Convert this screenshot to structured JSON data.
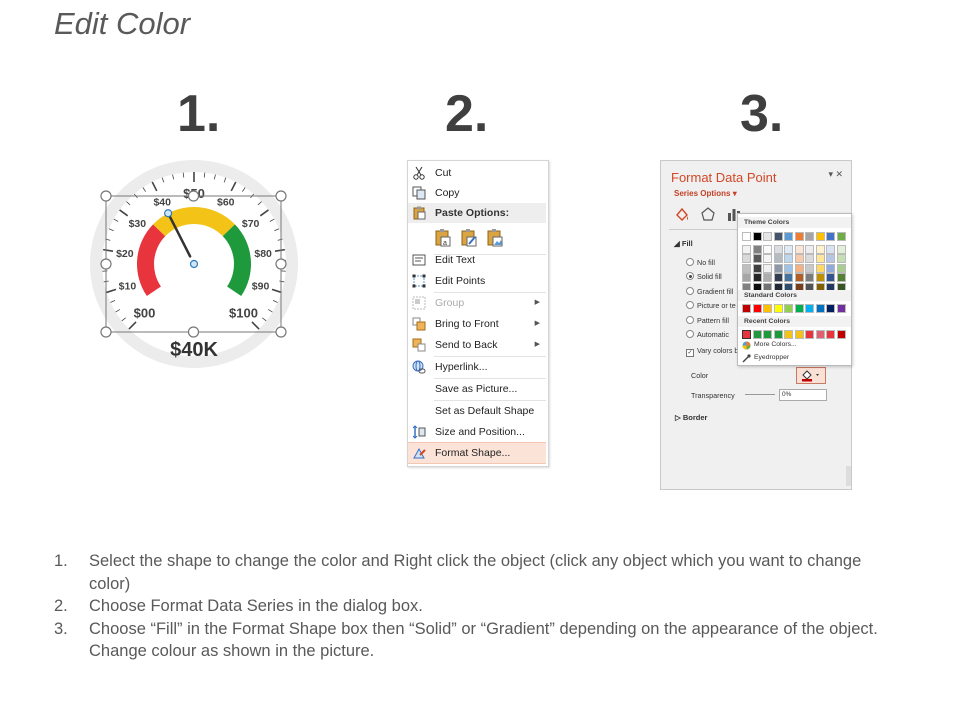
{
  "title": "Edit Color",
  "steps": [
    "1.",
    "2.",
    "3."
  ],
  "gauge": {
    "tick_labels": [
      "$00",
      "$10",
      "$20",
      "$30",
      "$40",
      "$50",
      "$60",
      "$70",
      "$80",
      "$90",
      "$100"
    ],
    "value_label": "$40K",
    "needle_value": 40,
    "band_colors": {
      "low": "#e8343c",
      "mid": "#f4c318",
      "high": "#1e9a3c"
    }
  },
  "context_menu": {
    "items": {
      "cut": "Cut",
      "copy": "Copy",
      "paste_options": "Paste Options:",
      "edit_text": "Edit Text",
      "edit_points": "Edit Points",
      "group": "Group",
      "bring_to_front": "Bring to Front",
      "send_to_back": "Send to Back",
      "hyperlink": "Hyperlink...",
      "save_as_picture": "Save as Picture...",
      "set_default_shape": "Set as Default Shape",
      "size_and_position": "Size and Position...",
      "format_shape": "Format Shape..."
    }
  },
  "format_panel": {
    "title": "Format Data Point",
    "series_options": "Series Options",
    "controls": "▾ ✕",
    "fill_section": "Fill",
    "fill_options": [
      "No fill",
      "Solid fill",
      "Gradient fill",
      "Picture or te",
      "Pattern fill",
      "Automatic"
    ],
    "selected_fill": "Solid fill",
    "vary_colors": "Vary colors b",
    "color_label": "Color",
    "transparency_label": "Transparency",
    "transparency_value": "0%",
    "border_section": "Border",
    "accent_color": "#d24726"
  },
  "color_popup": {
    "theme_colors_label": "Theme Colors",
    "standard_colors_label": "Standard Colors",
    "recent_colors_label": "Recent Colors",
    "more_colors": "More Colors...",
    "eyedropper": "Eyedropper",
    "theme_top_row": [
      "#ffffff",
      "#000000",
      "#e7e6e6",
      "#44546a",
      "#5b9bd5",
      "#ed7d31",
      "#a5a5a5",
      "#ffc000",
      "#4472c4",
      "#70ad47"
    ],
    "standard_colors": [
      "#c00000",
      "#ff0000",
      "#ffc000",
      "#ffff00",
      "#92d050",
      "#00b050",
      "#00b0f0",
      "#0070c0",
      "#002060",
      "#7030a0"
    ],
    "recent_colors": [
      "#e8343c",
      "#1e9a3c",
      "#1e9a3c",
      "#1e9a3c",
      "#f4c318",
      "#f4c318",
      "#e8343c",
      "#e06070",
      "#e8343c",
      "#c00000"
    ]
  },
  "instructions": [
    {
      "num": "1.",
      "text": "Select the shape to change the color and Right click the object (click any object which you want to change color)"
    },
    {
      "num": "2.",
      "text": "Choose Format Data Series in the dialog box."
    },
    {
      "num": "3.",
      "text": "Choose “Fill” in the Format Shape box then “Solid” or “Gradient” depending on the appearance of the object. Change colour as shown in the picture."
    }
  ]
}
